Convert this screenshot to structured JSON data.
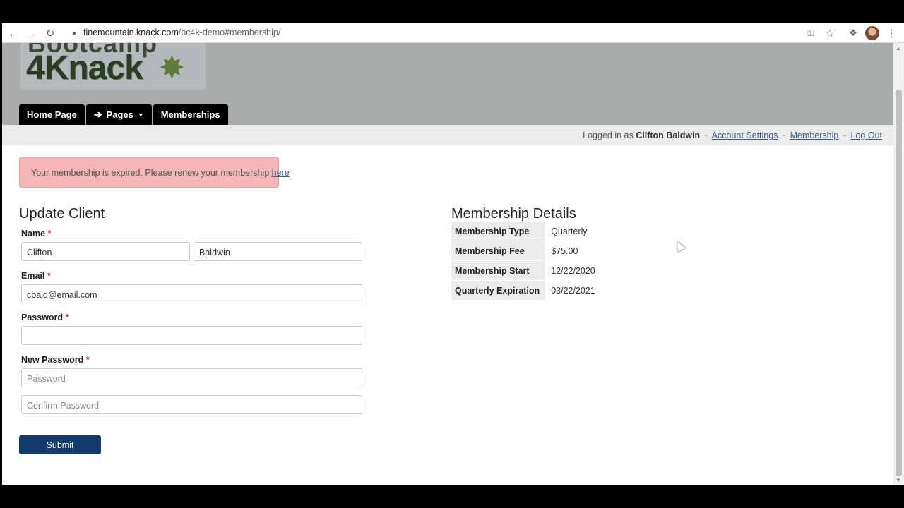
{
  "browser": {
    "url_host": "finemountain.knack.com",
    "url_path": "/bc4k-demo#membership/"
  },
  "logo": {
    "line1": "Bootcamp",
    "line2": "4Knack"
  },
  "nav": {
    "home": "Home Page",
    "pages": "Pages",
    "memberships": "Memberships"
  },
  "userbar": {
    "prefix": "Logged in as",
    "user": "Clifton Baldwin",
    "account_settings": "Account Settings",
    "membership": "Membership",
    "logout": "Log Out",
    "sep": "-"
  },
  "alert": {
    "text": "Your membership is expired. Please renew your membership ",
    "link": "here"
  },
  "form": {
    "title": "Update Client",
    "name_label": "Name",
    "first_name": "Clifton",
    "last_name": "Baldwin",
    "email_label": "Email",
    "email": "cbald@email.com",
    "password_label": "Password",
    "new_password_label": "New Password",
    "new_password_placeholder": "Password",
    "confirm_placeholder": "Confirm Password",
    "required_mark": "*",
    "submit": "Submit"
  },
  "details": {
    "title": "Membership Details",
    "rows": [
      {
        "key": "Membership Type",
        "value": "Quarterly"
      },
      {
        "key": "Membership Fee",
        "value": "$75.00"
      },
      {
        "key": "Membership Start",
        "value": "12/22/2020"
      },
      {
        "key": "Quarterly Expiration",
        "value": "03/22/2021"
      }
    ]
  },
  "colors": {
    "nav_bg": "#000000",
    "header_bg": "#a9acab",
    "alert_bg": "#f4b6b6",
    "submit_bg": "#123b6b"
  }
}
